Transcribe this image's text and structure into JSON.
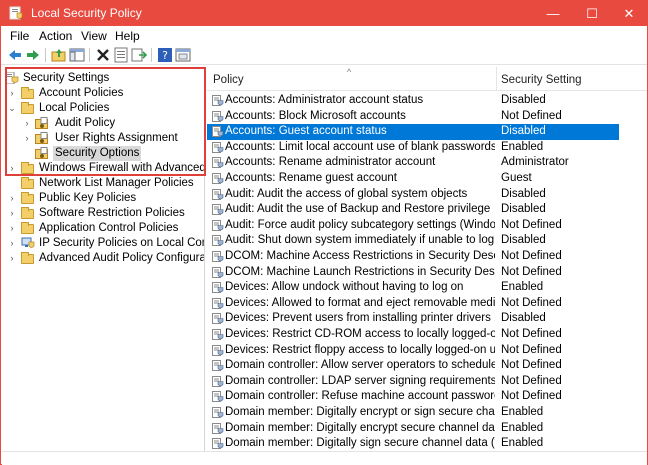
{
  "window": {
    "title": "Local Security Policy",
    "accent_color": "#e84a3f",
    "controls": {
      "minimize": "—",
      "maximize": "☐",
      "close": "✕"
    }
  },
  "menu": [
    "File",
    "Action",
    "View",
    "Help"
  ],
  "toolbar": [
    "back-icon",
    "forward-icon",
    "up-folder-icon",
    "show-pane-icon",
    "delete-icon",
    "properties-icon",
    "export-icon",
    "help-icon",
    "console-icon"
  ],
  "tree": [
    {
      "label": "Security Settings",
      "indent": 0,
      "chevron": "",
      "icon": "security-settings-icon"
    },
    {
      "label": "Account Policies",
      "indent": 1,
      "chevron": "›",
      "icon": "folder-icon"
    },
    {
      "label": "Local Policies",
      "indent": 1,
      "chevron": "⌄",
      "icon": "folder-open-icon"
    },
    {
      "label": "Audit Policy",
      "indent": 2,
      "chevron": "›",
      "icon": "policy-folder-icon"
    },
    {
      "label": "User Rights Assignment",
      "indent": 2,
      "chevron": "›",
      "icon": "policy-folder-icon"
    },
    {
      "label": "Security Options",
      "indent": 2,
      "chevron": "",
      "icon": "policy-folder-icon",
      "selected": true
    },
    {
      "label": "Windows Firewall with Advanced Sec",
      "indent": 1,
      "chevron": "›",
      "icon": "folder-icon"
    },
    {
      "label": "Network List Manager Policies",
      "indent": 1,
      "chevron": "",
      "icon": "folder-icon"
    },
    {
      "label": "Public Key Policies",
      "indent": 1,
      "chevron": "›",
      "icon": "folder-icon"
    },
    {
      "label": "Software Restriction Policies",
      "indent": 1,
      "chevron": "›",
      "icon": "folder-icon"
    },
    {
      "label": "Application Control Policies",
      "indent": 1,
      "chevron": "›",
      "icon": "folder-icon"
    },
    {
      "label": "IP Security Policies on Local Compute",
      "indent": 1,
      "chevron": "›",
      "icon": "ip-security-icon"
    },
    {
      "label": "Advanced Audit Policy Configuration",
      "indent": 1,
      "chevron": "›",
      "icon": "folder-icon"
    }
  ],
  "list": {
    "columns": [
      "Policy",
      "Security Setting"
    ],
    "sort_indicator": "^",
    "rows": [
      {
        "policy": "Accounts: Administrator account status",
        "setting": "Disabled"
      },
      {
        "policy": "Accounts: Block Microsoft accounts",
        "setting": "Not Defined"
      },
      {
        "policy": "Accounts: Guest account status",
        "setting": "Disabled",
        "selected": true
      },
      {
        "policy": "Accounts: Limit local account use of blank passwords to co...",
        "setting": "Enabled"
      },
      {
        "policy": "Accounts: Rename administrator account",
        "setting": "Administrator"
      },
      {
        "policy": "Accounts: Rename guest account",
        "setting": "Guest"
      },
      {
        "policy": "Audit: Audit the access of global system objects",
        "setting": "Disabled"
      },
      {
        "policy": "Audit: Audit the use of Backup and Restore privilege",
        "setting": "Disabled"
      },
      {
        "policy": "Audit: Force audit policy subcategory settings (Windows Vis...",
        "setting": "Not Defined"
      },
      {
        "policy": "Audit: Shut down system immediately if unable to log secur...",
        "setting": "Disabled"
      },
      {
        "policy": "DCOM: Machine Access Restrictions in Security Descriptor D...",
        "setting": "Not Defined"
      },
      {
        "policy": "DCOM: Machine Launch Restrictions in Security Descriptor ...",
        "setting": "Not Defined"
      },
      {
        "policy": "Devices: Allow undock without having to log on",
        "setting": "Enabled"
      },
      {
        "policy": "Devices: Allowed to format and eject removable media",
        "setting": "Not Defined"
      },
      {
        "policy": "Devices: Prevent users from installing printer drivers",
        "setting": "Disabled"
      },
      {
        "policy": "Devices: Restrict CD-ROM access to locally logged-on user ...",
        "setting": "Not Defined"
      },
      {
        "policy": "Devices: Restrict floppy access to locally logged-on user only",
        "setting": "Not Defined"
      },
      {
        "policy": "Domain controller: Allow server operators to schedule tasks",
        "setting": "Not Defined"
      },
      {
        "policy": "Domain controller: LDAP server signing requirements",
        "setting": "Not Defined"
      },
      {
        "policy": "Domain controller: Refuse machine account password chan...",
        "setting": "Not Defined"
      },
      {
        "policy": "Domain member: Digitally encrypt or sign secure channel d...",
        "setting": "Enabled"
      },
      {
        "policy": "Domain member: Digitally encrypt secure channel data (wh...",
        "setting": "Enabled"
      },
      {
        "policy": "Domain member: Digitally sign secure channel data (when...",
        "setting": "Enabled"
      }
    ]
  },
  "colors": {
    "selection": "#0078d7",
    "tree_selection": "#d9d9d9",
    "highlight_box": "#e0403a"
  }
}
